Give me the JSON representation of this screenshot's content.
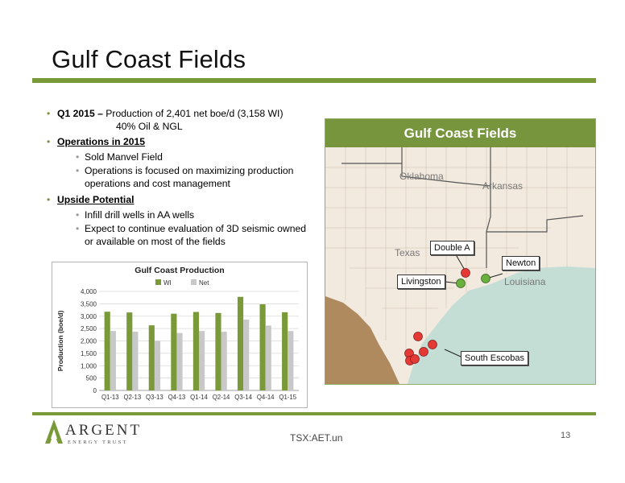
{
  "slide": {
    "title": "Gulf Coast Fields",
    "page_number": "13",
    "ticker": "TSX:AET.un"
  },
  "bullets": {
    "q1_label": "Q1 2015 –",
    "q1_text": " Production of 2,401 net boe/d (3,158 WI)",
    "q1_text2": "40% Oil & NGL",
    "ops_label": "Operations in 2015",
    "ops_items": [
      "Sold Manvel Field",
      "Operations is focused on maximizing production operations and cost management"
    ],
    "upside_label": "Upside Potential",
    "upside_items": [
      "Infill drill wells in AA wells",
      "Expect to continue evaluation of 3D seismic owned or available on most of the fields"
    ]
  },
  "chart_data": {
    "type": "bar",
    "title": "Gulf Coast Production",
    "ylabel": "Production (boe/d)",
    "xlabel": "",
    "categories": [
      "Q1-13",
      "Q2-13",
      "Q3-13",
      "Q4-13",
      "Q1-14",
      "Q2-14",
      "Q3-14",
      "Q4-14",
      "Q1-15"
    ],
    "series": [
      {
        "name": "WI",
        "color": "#7a9a3a",
        "values": [
          3180,
          3150,
          2630,
          3100,
          3170,
          3130,
          3780,
          3480,
          3158
        ]
      },
      {
        "name": "Net",
        "color": "#c8c8c8",
        "values": [
          2400,
          2370,
          2000,
          2320,
          2400,
          2370,
          2860,
          2620,
          2401
        ]
      }
    ],
    "ylim": [
      0,
      4000
    ],
    "yticks": [
      "0",
      "500",
      "1,000",
      "1,500",
      "2,000",
      "2,500",
      "3,000",
      "3,500",
      "4,000"
    ],
    "legend": "top"
  },
  "map": {
    "header": "Gulf Coast Fields",
    "states": [
      "Oklahoma",
      "Arkansas",
      "Texas",
      "Louisiana"
    ],
    "callouts": [
      "Double A",
      "Newton",
      "Livingston",
      "South Escobas"
    ],
    "colors": {
      "oil_field": "#e53935",
      "gas_field": "#6ab03e",
      "land": "#f3eadf",
      "mexico": "#b08a5f",
      "water": "#c4ded6"
    }
  },
  "logo": {
    "word": "ARGENT",
    "sub": "ENERGY TRUST"
  }
}
